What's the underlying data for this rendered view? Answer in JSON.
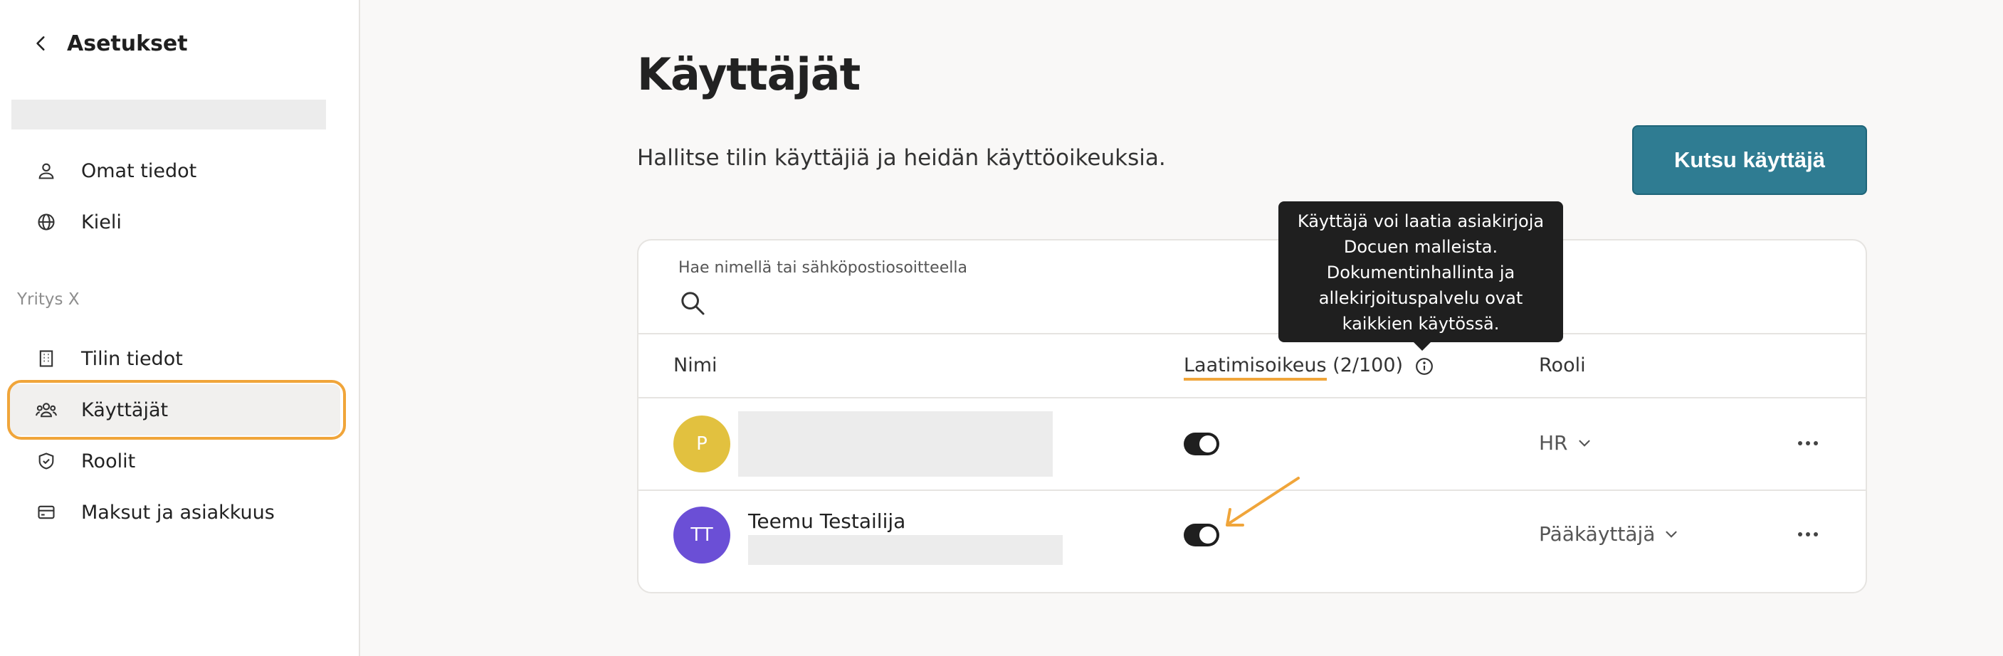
{
  "sidebar": {
    "title": "Asetukset",
    "items": [
      {
        "label": "Omat tiedot",
        "icon": "user-icon"
      },
      {
        "label": "Kieli",
        "icon": "globe-icon"
      }
    ],
    "section_label": "Yritys X",
    "company_items": [
      {
        "label": "Tilin tiedot",
        "icon": "building-icon"
      },
      {
        "label": "Käyttäjät",
        "icon": "users-icon",
        "active": true
      },
      {
        "label": "Roolit",
        "icon": "shield-check-icon"
      },
      {
        "label": "Maksut ja asiakkuus",
        "icon": "credit-card-icon"
      }
    ]
  },
  "main": {
    "title": "Käyttäjät",
    "description": "Hallitse tilin käyttäjiä ja heidän käyttöoikeuksia.",
    "invite_button": "Kutsu käyttäjä",
    "search": {
      "label": "Hae nimellä tai sähköpostiosoitteella"
    },
    "table": {
      "headers": {
        "name": "Nimi",
        "drafting": "Laatimisoikeus",
        "drafting_count": "(2/100)",
        "role": "Rooli"
      },
      "rows": [
        {
          "avatar": "P",
          "avatar_color": "#e2c13f",
          "name": "",
          "drafting_enabled": true,
          "role": "HR"
        },
        {
          "avatar": "TT",
          "avatar_color": "#6b4fd6",
          "name": "Teemu Testailija",
          "drafting_enabled": true,
          "role": "Pääkäyttäjä"
        }
      ]
    },
    "tooltip": {
      "lines": [
        "Käyttäjä voi laatia asiakirjoja",
        "Docuen malleista.",
        "Dokumentinhallinta ja",
        "allekirjoituspalvelu ovat",
        "kaikkien käytössä."
      ]
    }
  },
  "colors": {
    "accent": "#2f7c92",
    "highlight": "#f0a53a"
  }
}
